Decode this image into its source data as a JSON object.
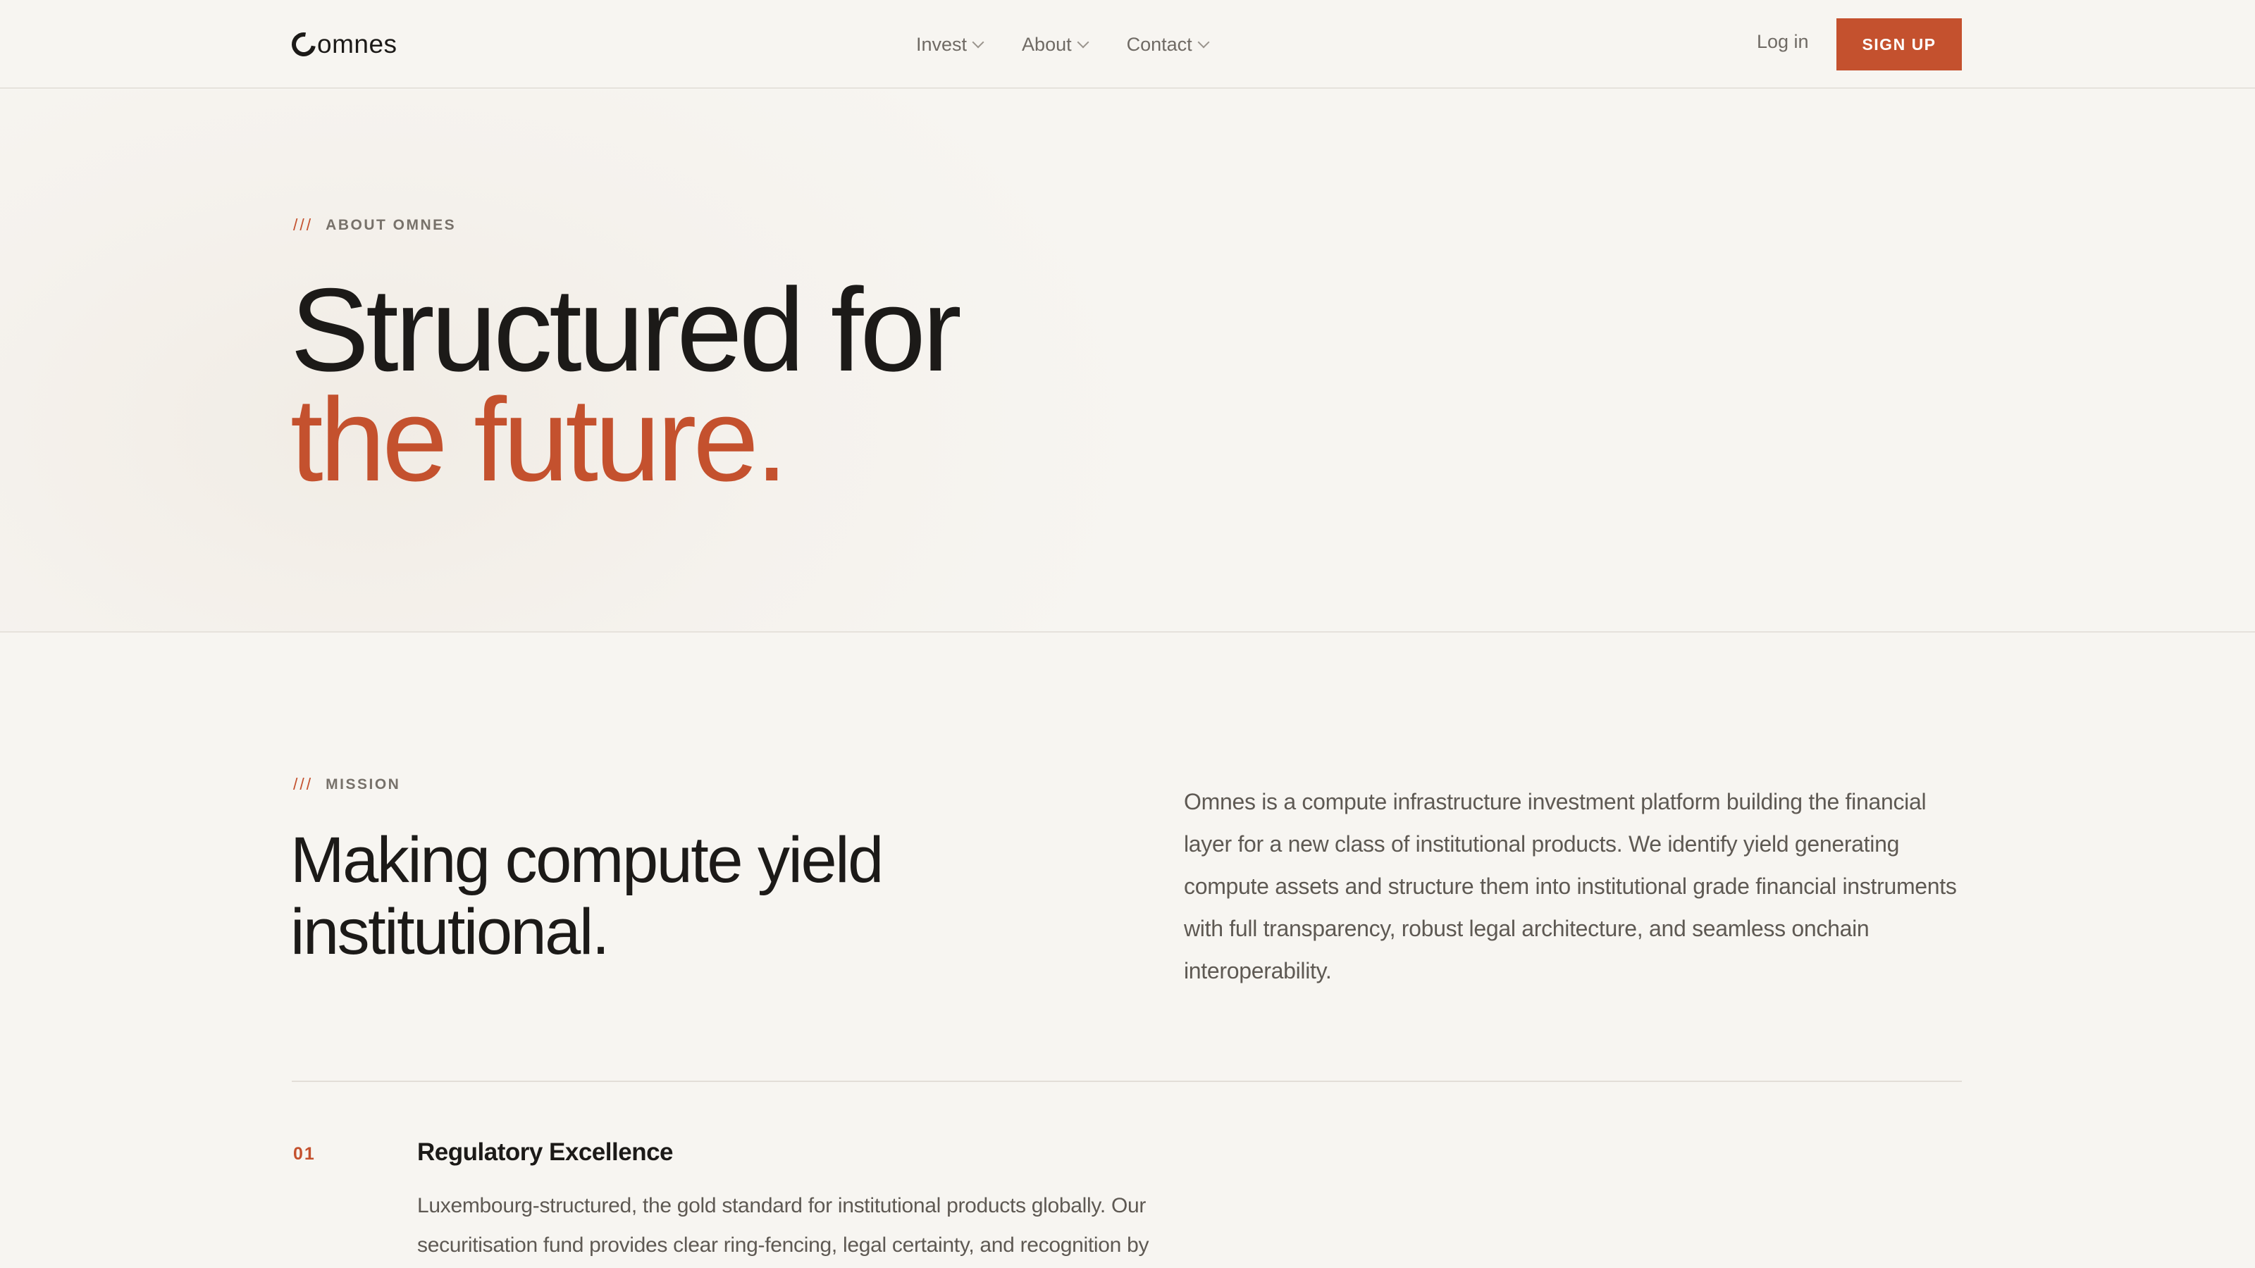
{
  "brand": {
    "name": "omnes",
    "accent": "#c4512e",
    "logo_icon": "ring-icon"
  },
  "nav": {
    "menu": [
      {
        "label": "Invest",
        "icon": "chevron-down-icon"
      },
      {
        "label": "About",
        "icon": "chevron-down-icon"
      },
      {
        "label": "Contact",
        "icon": "chevron-down-icon"
      }
    ],
    "login_label": "Log in",
    "signup_label": "SIGN UP"
  },
  "hero": {
    "eyebrow_mark": "///",
    "eyebrow": "ABOUT OMNES",
    "title_line1": "Structured for",
    "title_line2": "the future."
  },
  "mission": {
    "eyebrow_mark": "///",
    "eyebrow": "MISSION",
    "title": "Making compute yield institutional.",
    "body": "Omnes is a compute infrastructure investment platform building the financial layer for a new class of institutional products. We identify yield generating compute assets and structure them into institutional grade financial instruments with full transparency, robust legal architecture, and seamless onchain interoperability."
  },
  "features": [
    {
      "number": "01",
      "title": "Regulatory Excellence",
      "body": "Luxembourg-structured, the gold standard for institutional products globally. Our securitisation fund provides clear ring-fencing, legal certainty, and recognition by"
    }
  ]
}
